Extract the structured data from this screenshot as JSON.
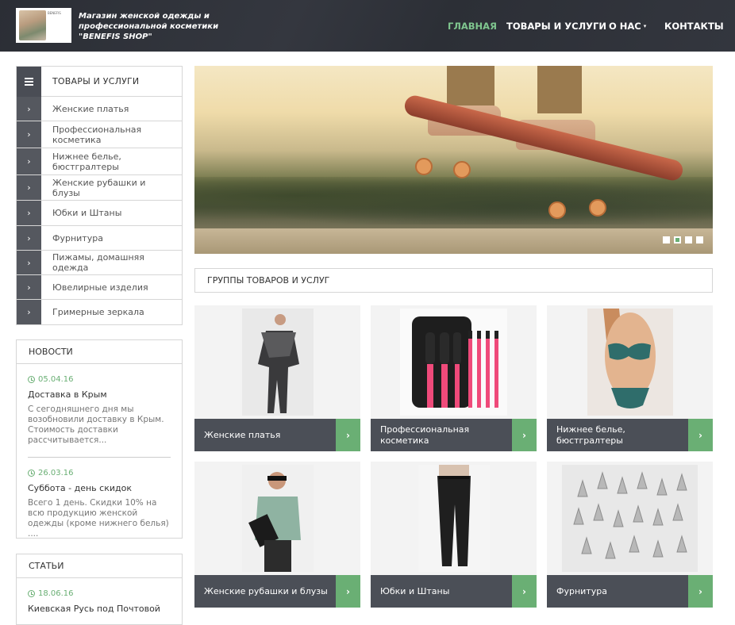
{
  "header": {
    "logo_text": "BENEFIS",
    "title": "Магазин женской одежды и профессиональной косметики \"BENEFIS SHOP\"",
    "nav": [
      {
        "label": "ГЛАВНАЯ"
      },
      {
        "label": "ТОВАРЫ И УСЛУГИ"
      },
      {
        "label": "О НАС"
      },
      {
        "label": "КОНТАКТЫ"
      }
    ],
    "active_color": "#7fc68f"
  },
  "sidebar": {
    "menu_title": "ТОВАРЫ И УСЛУГИ",
    "items": [
      {
        "label": "Женские платья"
      },
      {
        "label": "Профессиональная косметика"
      },
      {
        "label": "Нижнее белье, бюстгралтеры"
      },
      {
        "label": "Женские рубашки и блузы"
      },
      {
        "label": "Юбки и Штаны"
      },
      {
        "label": "Фурнитура"
      },
      {
        "label": "Пижамы, домашняя одежда"
      },
      {
        "label": "Ювелирные изделия"
      },
      {
        "label": "Гримерные зеркала"
      }
    ],
    "news": {
      "title": "НОВОСТИ",
      "items": [
        {
          "date": "05.04.16",
          "title": "Доставка в Крым",
          "text": "С сегодняшнего дня мы возобновили доставку в Крым. Стоимость доставки рассчитывается..."
        },
        {
          "date": "26.03.16",
          "title": "Суббота - день скидок",
          "text": "Всего 1 день. Скидки 10% на всю продукцию женской одежды (кроме нижнего белья) ...."
        }
      ]
    },
    "articles": {
      "title": "СТАТЬИ",
      "items": [
        {
          "date": "18.06.16",
          "title": "Киевская Русь под Почтовой"
        }
      ]
    }
  },
  "main": {
    "group_title": "ГРУППЫ ТОВАРОВ И УСЛУГ",
    "products": [
      {
        "name": "Женские платья"
      },
      {
        "name": "Профессиональная косметика"
      },
      {
        "name": "Нижнее белье, бюстгралтеры"
      },
      {
        "name": "Женские рубашки и блузы"
      },
      {
        "name": "Юбки и Штаны"
      },
      {
        "name": "Фурнитура"
      }
    ]
  },
  "icons": {
    "menu_arrow": "›",
    "card_arrow": "›",
    "nav_caret": "▾"
  },
  "colors": {
    "header_bg": "#2e3138",
    "accent_green": "#6aaf74",
    "dark_bar": "#4b4f57"
  }
}
